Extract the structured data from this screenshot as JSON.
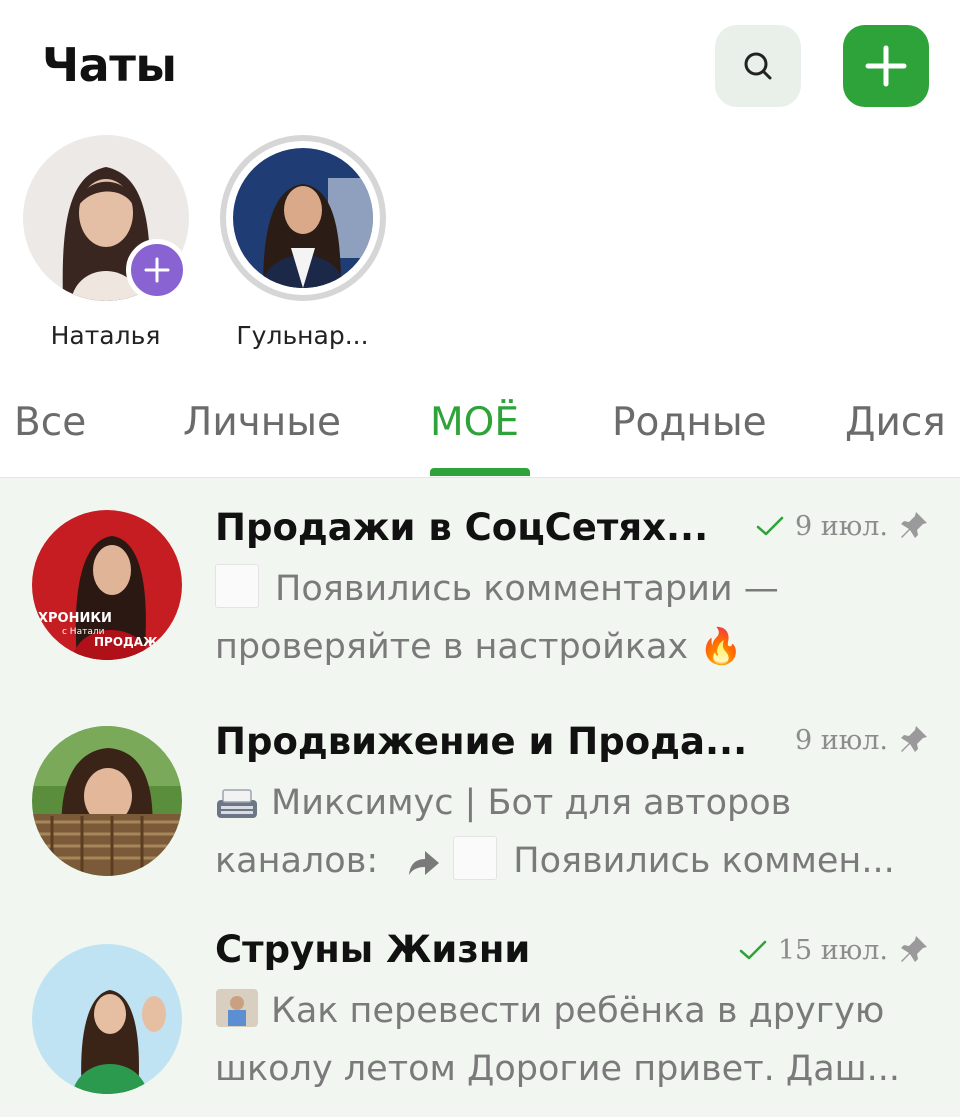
{
  "header": {
    "title": "Чаты",
    "search_icon": "search-icon",
    "add_icon": "plus-icon",
    "accent": "#2ea339"
  },
  "stories": [
    {
      "name": "Наталья",
      "has_add_badge": true
    },
    {
      "name": "Гульнар..."
    }
  ],
  "tabs": [
    {
      "label": "Все"
    },
    {
      "label": "Личные"
    },
    {
      "label": "МОЁ",
      "active": true
    },
    {
      "label": "Родные"
    },
    {
      "label": "Дися"
    }
  ],
  "chats": [
    {
      "name": "Продажи в СоцСетях...",
      "date": "9 июл.",
      "read_check": true,
      "pinned": true,
      "preview_line1": "Появились комментарии —",
      "preview_line2": "проверяйте в настройках",
      "preview_emoji": "🔥",
      "avatar_text_1": "ХРОНИКИ",
      "avatar_text_2": "с Натали",
      "avatar_text_3": "ПРОДАЖ"
    },
    {
      "name": "Продвижение и Прода...",
      "date": "9 июл.",
      "read_check": false,
      "pinned": true,
      "preview_line1": "Миксимус | Бот для авторов",
      "preview_line2a": "каналов:",
      "preview_line2b": "Появились коммен..."
    },
    {
      "name": "Струны Жизни",
      "date": "15 июл.",
      "read_check": true,
      "pinned": true,
      "preview_line1": "Как перевести ребёнка в другую",
      "preview_line2": "школу летом Дорогие привет. Даш..."
    }
  ]
}
